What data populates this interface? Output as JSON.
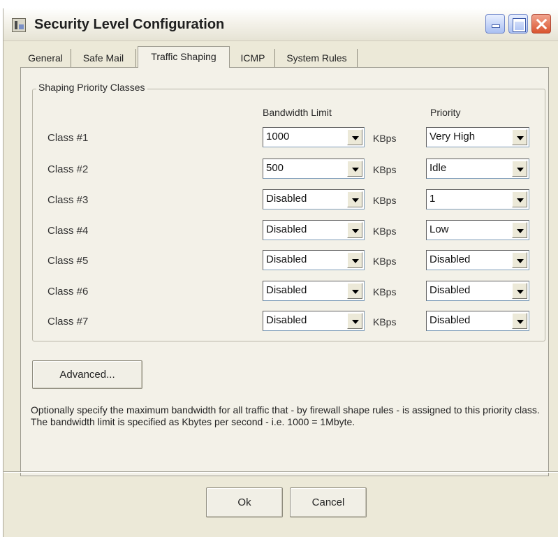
{
  "window": {
    "title": "Security Level Configuration",
    "icon": "app-icon",
    "controls": [
      "minimize-icon",
      "maximize-icon",
      "close-icon"
    ]
  },
  "tabs": [
    {
      "label": "General",
      "active": false
    },
    {
      "label": "Safe Mail",
      "active": false
    },
    {
      "label": "Traffic Shaping",
      "active": true
    },
    {
      "label": "ICMP",
      "active": false
    },
    {
      "label": "System Rules",
      "active": false
    }
  ],
  "group": {
    "legend": "Shaping Priority Classes",
    "bandwidth_header": "Bandwidth Limit",
    "priority_header": "Priority",
    "unit": "KBps",
    "rows": [
      {
        "label": "Class #1",
        "bandwidth": "1000",
        "priority": "Very High"
      },
      {
        "label": "Class #2",
        "bandwidth": "500",
        "priority": "Idle"
      },
      {
        "label": "Class #3",
        "bandwidth": "Disabled",
        "priority": "1"
      },
      {
        "label": "Class #4",
        "bandwidth": "Disabled",
        "priority": "Low"
      },
      {
        "label": "Class #5",
        "bandwidth": "Disabled",
        "priority": "Disabled"
      },
      {
        "label": "Class #6",
        "bandwidth": "Disabled",
        "priority": "Disabled"
      },
      {
        "label": "Class #7",
        "bandwidth": "Disabled",
        "priority": "Disabled"
      }
    ]
  },
  "advanced_label": "Advanced...",
  "help_text": "Optionally specify the maximum bandwidth for all traffic that - by firewall shape rules - is assigned to this priority class. The bandwidth limit is specified as Kbytes per second - i.e. 1000 = 1Mbyte.",
  "footer": {
    "ok_label": "Ok",
    "cancel_label": "Cancel"
  },
  "colors": {
    "window_bg": "#ece9d8",
    "panel_bg": "#f3f1e8",
    "border": "#7f9db9"
  }
}
